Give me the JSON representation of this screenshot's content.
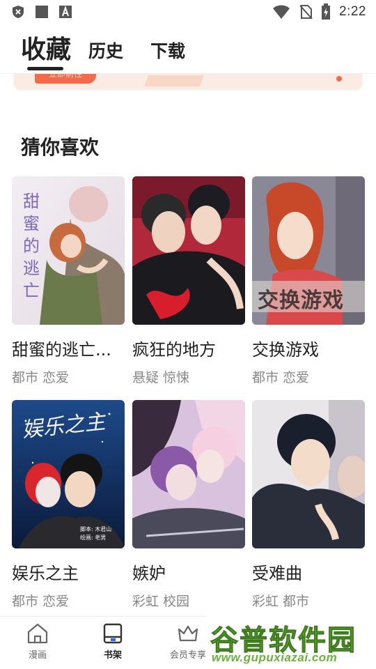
{
  "status_bar": {
    "time": "2:22",
    "left_icons": [
      "shield-x-icon",
      "square-icon",
      "a-box-icon"
    ],
    "right_icons": [
      "wifi-icon",
      "no-sim-icon",
      "battery-charging-icon"
    ]
  },
  "header": {
    "tabs": [
      {
        "label": "收藏",
        "active": true
      },
      {
        "label": "历史",
        "active": false
      },
      {
        "label": "下载",
        "active": false
      }
    ]
  },
  "banner": {
    "button_label": "立即前往"
  },
  "recommend": {
    "title": "猜你喜欢",
    "items": [
      {
        "title": "甜蜜的逃亡...",
        "tags": "都市 恋爱"
      },
      {
        "title": "疯狂的地方",
        "tags": "悬疑 惊悚"
      },
      {
        "title": "交换游戏",
        "tags": "都市 恋爱"
      },
      {
        "title": "娱乐之主",
        "tags": "都市 恋爱"
      },
      {
        "title": "嫉妒",
        "tags": "彩虹 校园"
      },
      {
        "title": "受难曲",
        "tags": "彩虹 都市"
      }
    ]
  },
  "covers": {
    "c1_text": "甜蜜的逃亡",
    "c3_text": "交换游戏",
    "c4_text": "娱乐之主",
    "c4_credit1": "脚本: 木君山",
    "c4_credit2": "绘画: 老男"
  },
  "bottom_nav": {
    "items": [
      {
        "label": "漫画",
        "icon": "home-icon"
      },
      {
        "label": "书架",
        "icon": "bookshelf-icon",
        "active": true
      },
      {
        "label": "会员专享",
        "icon": "vip-crown-icon"
      }
    ]
  },
  "watermark": {
    "title": "谷普软件园",
    "url": "www.gupuxiazai.com"
  },
  "colors": {
    "accent": "#f26b4a",
    "watermark_green": "#6cb33e"
  }
}
